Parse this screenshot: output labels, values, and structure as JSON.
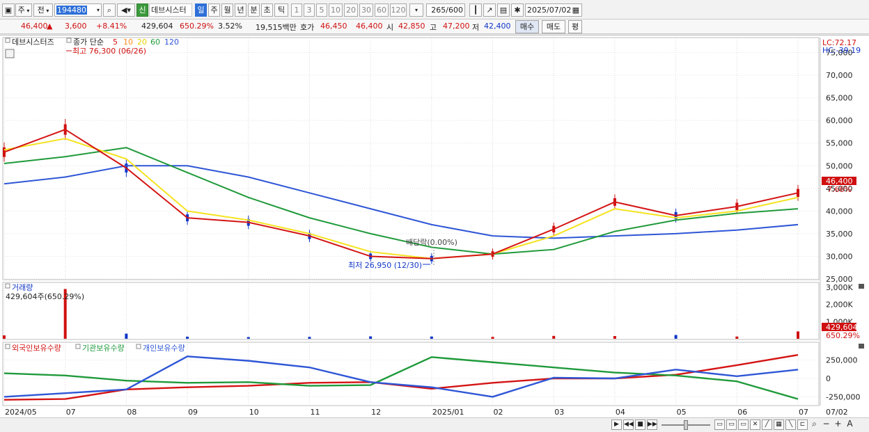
{
  "toolbar": {
    "market": "주",
    "prev": "전",
    "code": "194480",
    "new_label": "신",
    "stock_name": "데브시스터",
    "period_tabs": [
      "일",
      "주",
      "월",
      "년",
      "분",
      "초",
      "틱"
    ],
    "active_period": "일",
    "intervals": [
      "1",
      "3",
      "5",
      "10",
      "20",
      "30",
      "60",
      "120"
    ],
    "count": "265",
    "count_max": "/600",
    "date": "2025/07/02"
  },
  "quote": {
    "price": "46,400",
    "arrow": "▲",
    "change": "3,600",
    "rate": "+8.41%",
    "volume": "429,604",
    "volume_ratio": "650.29%",
    "turnover": "3.52%",
    "amount": "19,515백만",
    "hoga_label": "호가",
    "bid1": "46,450",
    "bid2": "46,400",
    "open_label": "시",
    "open": "42,850",
    "high_label": "고",
    "high": "47,200",
    "low_label": "저",
    "low": "42,400",
    "buy": "매수",
    "sell": "매도",
    "eval": "평"
  },
  "price_panel": {
    "title": "데브시스터즈",
    "ma_legend_prefix": "종가 단순",
    "ma_periods": [
      "5",
      "10",
      "20",
      "60",
      "120"
    ],
    "lc": "LC:72.17",
    "hc": "HC:-39.19",
    "high_note": "최고 76,300 (06/26)",
    "low_note": "최저 26,950 (12/30)",
    "dividend_note": "배당락(0.00%)",
    "last_price": "46,400",
    "last_rate": "7.66%",
    "y_ticks": [
      "75,000",
      "70,000",
      "65,000",
      "60,000",
      "55,000",
      "50,000",
      "45,000",
      "40,000",
      "35,000",
      "30,000",
      "25,000"
    ]
  },
  "volume_panel": {
    "title": "거래량",
    "current": "429,604주(650.29%)",
    "y_ticks": [
      "3,000K",
      "2,000K",
      "1,000K"
    ],
    "last_volume": "429,604",
    "last_ratio": "650.29%"
  },
  "holders_panel": {
    "legend": [
      "외국인보유수량",
      "기관보유수량",
      "개인보유수량"
    ],
    "y_ticks": [
      "250,000",
      "0",
      "-250,000"
    ]
  },
  "x_axis": {
    "labels": [
      "2024/05",
      "07",
      "08",
      "09",
      "10",
      "11",
      "12",
      "2025/01",
      "02",
      "03",
      "04",
      "05",
      "06",
      "07"
    ],
    "right_label": "07/02"
  },
  "colors": {
    "up": "#d01010",
    "down": "#1036c8",
    "ma5": "#d41414",
    "ma10": "#ff8c1a",
    "ma20": "#f5e320",
    "ma60": "#1f9a3a",
    "ma120": "#2e56d6",
    "foreign": "#d41414",
    "institution": "#1f9a3a",
    "individual": "#2e56d6"
  },
  "chart_data": [
    {
      "type": "line",
      "title": "데브시스터즈",
      "y_unit": "원",
      "ylim": [
        25000,
        76000
      ],
      "x": [
        "2024/05",
        "07",
        "08",
        "09",
        "10",
        "11",
        "12",
        "2025/01",
        "02",
        "03",
        "04",
        "05",
        "06",
        "07"
      ],
      "series": [
        {
          "name": "5",
          "values": [
            53000,
            58000,
            49500,
            38500,
            37500,
            34500,
            30000,
            29500,
            30500,
            36000,
            42000,
            39000,
            41000,
            44000
          ]
        },
        {
          "name": "20",
          "values": [
            53500,
            56000,
            51500,
            40000,
            38000,
            35000,
            31000,
            29500,
            30500,
            34500,
            40500,
            38500,
            40000,
            43000
          ]
        },
        {
          "name": "60",
          "values": [
            50500,
            52000,
            54000,
            48500,
            43000,
            38500,
            35000,
            32000,
            30500,
            31500,
            35500,
            38000,
            39500,
            40500
          ]
        },
        {
          "name": "120",
          "values": [
            46000,
            47500,
            50000,
            50000,
            47500,
            44000,
            40500,
            37000,
            34500,
            34000,
            34500,
            35000,
            35800,
            37000
          ]
        }
      ]
    },
    {
      "type": "bar",
      "title": "거래량",
      "ylim": [
        0,
        3000
      ],
      "y_unit": "K",
      "x": [
        "2024/05",
        "07",
        "08",
        "09",
        "10",
        "11",
        "12",
        "2025/01",
        "02",
        "03",
        "04",
        "05",
        "06",
        "07"
      ],
      "values": [
        200,
        2900,
        300,
        120,
        100,
        110,
        140,
        130,
        110,
        170,
        160,
        220,
        130,
        430
      ]
    },
    {
      "type": "line",
      "title": "보유수량",
      "ylim": [
        -350000,
        350000
      ],
      "x": [
        "2024/05",
        "07",
        "08",
        "09",
        "10",
        "11",
        "12",
        "2025/01",
        "02",
        "03",
        "04",
        "05",
        "06",
        "07"
      ],
      "series": [
        {
          "name": "외국인보유수량",
          "values": [
            -290000,
            -280000,
            -150000,
            -120000,
            -100000,
            -60000,
            -50000,
            -140000,
            -60000,
            0,
            0,
            50000,
            180000,
            320000
          ]
        },
        {
          "name": "기관보유수량",
          "values": [
            70000,
            40000,
            -30000,
            -60000,
            -50000,
            -100000,
            -90000,
            290000,
            220000,
            150000,
            80000,
            40000,
            -40000,
            -280000
          ]
        },
        {
          "name": "개인보유수량",
          "values": [
            -250000,
            -200000,
            -150000,
            300000,
            240000,
            150000,
            -50000,
            -120000,
            -250000,
            10000,
            0,
            120000,
            30000,
            120000
          ]
        }
      ]
    }
  ]
}
